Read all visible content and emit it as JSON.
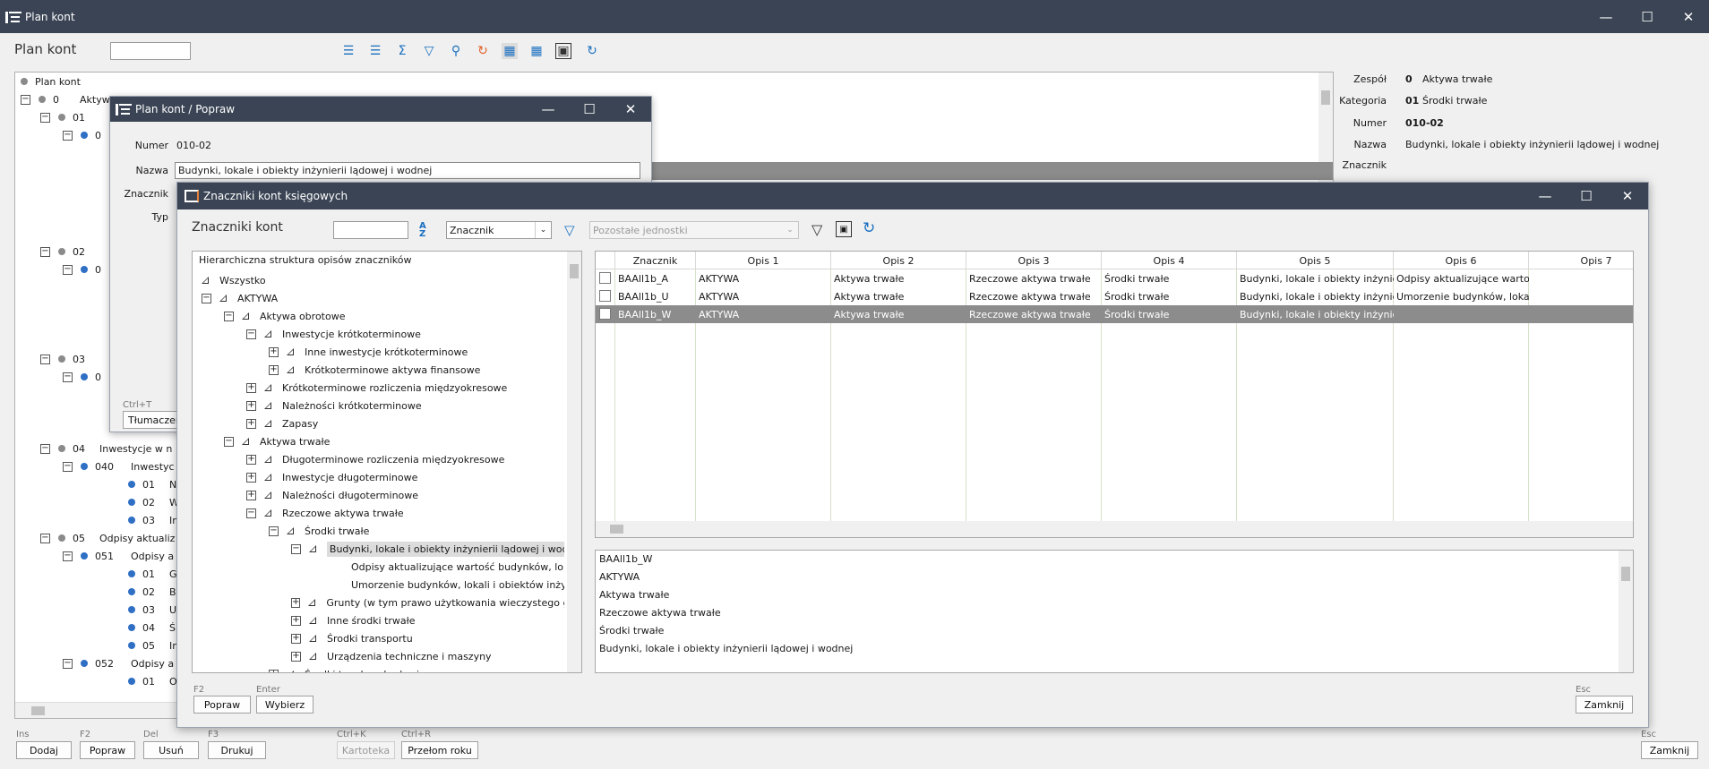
{
  "main_window": {
    "title": "Plan kont",
    "page_title": "Plan kont",
    "search_value": "",
    "tree": [
      {
        "code": "",
        "label": "Plan kont"
      },
      {
        "code": "0",
        "label": "Aktyw"
      },
      {
        "code": "01",
        "label": ""
      },
      {
        "code": "0",
        "label": ""
      },
      {
        "code": "02",
        "label": ""
      },
      {
        "code": "0",
        "label": ""
      },
      {
        "code": "03",
        "label": ""
      },
      {
        "code": "0",
        "label": ""
      },
      {
        "code": "04",
        "label": "Inwestycje w n"
      },
      {
        "code": "040",
        "label": "Inwestyc"
      },
      {
        "code": "01",
        "label": "Nieru"
      },
      {
        "code": "02",
        "label": "Warto"
      },
      {
        "code": "03",
        "label": "Inne i"
      },
      {
        "code": "05",
        "label": "Odpisy aktualiz"
      },
      {
        "code": "051",
        "label": "Odpisy a"
      },
      {
        "code": "01",
        "label": "Grun"
      },
      {
        "code": "02",
        "label": "Budy"
      },
      {
        "code": "03",
        "label": "Urzą"
      },
      {
        "code": "04",
        "label": "Środ"
      },
      {
        "code": "05",
        "label": "Inne s"
      },
      {
        "code": "052",
        "label": "Odpisy a"
      },
      {
        "code": "01",
        "label": "Odpis"
      }
    ],
    "details": {
      "zespol_label": "Zespół",
      "zespol_code": "0",
      "zespol_value": "Aktywa trwałe",
      "kategoria_label": "Kategoria",
      "kategoria_code": "01",
      "kategoria_value": "Środki trwałe",
      "numer_label": "Numer",
      "numer_value": "010-02",
      "nazwa_label": "Nazwa",
      "nazwa_value": "Budynki, lokale i obiekty inżynierii lądowej i wodnej",
      "znacznik_label": "Znacznik"
    },
    "bottom_buttons": [
      {
        "shortcut": "Ins",
        "label": "Dodaj"
      },
      {
        "shortcut": "F2",
        "label": "Popraw"
      },
      {
        "shortcut": "Del",
        "label": "Usuń"
      },
      {
        "shortcut": "F3",
        "label": "Drukuj"
      },
      {
        "shortcut": "Ctrl+K",
        "label": "Kartoteka"
      },
      {
        "shortcut": "Ctrl+R",
        "label": "Przełom roku"
      },
      {
        "shortcut": "Esc",
        "label": "Zamknij"
      }
    ]
  },
  "edit_window": {
    "title": "Plan kont / Popraw",
    "numer_label": "Numer",
    "numer_value": "010-02",
    "nazwa_label": "Nazwa",
    "nazwa_value": "Budynki, lokale i obiekty inżynierii lądowej i wodnej",
    "znacznik_label": "Znacznik",
    "typ_label": "Typ",
    "translate_shortcut": "Ctrl+T",
    "translate_button": "Tłumaczen"
  },
  "tags_window": {
    "title": "Znaczniki kont księgowych",
    "heading": "Znaczniki kont",
    "search_value": "",
    "sort_select": "Znacznik",
    "units_placeholder": "Pozostałe jednostki",
    "tree_header": "Hierarchiczna struktura opisów znaczników",
    "tree": [
      {
        "label": "Wszystko"
      },
      {
        "label": "AKTYWA"
      },
      {
        "label": "Aktywa obrotowe"
      },
      {
        "label": "Inwestycje krótkoterminowe"
      },
      {
        "label": "Inne inwestycje krótkoterminowe"
      },
      {
        "label": "Krótkoterminowe aktywa finansowe"
      },
      {
        "label": "Krótkoterminowe rozliczenia międzyokresowe"
      },
      {
        "label": "Należności krótkoterminowe"
      },
      {
        "label": "Zapasy"
      },
      {
        "label": "Aktywa trwałe"
      },
      {
        "label": "Długoterminowe rozliczenia międzyokresowe"
      },
      {
        "label": "Inwestycje długoterminowe"
      },
      {
        "label": "Należności długoterminowe"
      },
      {
        "label": "Rzeczowe aktywa trwałe"
      },
      {
        "label": "Środki trwałe"
      },
      {
        "label": "Budynki, lokale i obiekty inżynierii lądowej i wodnej"
      },
      {
        "label": "Odpisy aktualizujące wartość budynków, lokali i o"
      },
      {
        "label": "Umorzenie budynków, lokali i obiektów inżynierii lą"
      },
      {
        "label": "Grunty (w tym prawo użytkowania wieczystego grunt"
      },
      {
        "label": "Inne środki trwałe"
      },
      {
        "label": "Środki transportu"
      },
      {
        "label": "Urządzenia techniczne i maszyny"
      },
      {
        "label": "Środki trwałe w budowie"
      }
    ],
    "grid_columns": [
      "Znacznik",
      "Opis 1",
      "Opis 2",
      "Opis 3",
      "Opis 4",
      "Opis 5",
      "Opis 6",
      "Opis 7"
    ],
    "grid_rows": [
      [
        "BAAll1b_A",
        "AKTYWA",
        "Aktywa trwałe",
        "Rzeczowe aktywa trwałe",
        "Środki trwałe",
        "Budynki, lokale i obiekty inżynierii lą",
        "Odpisy aktualizujące wartość",
        ""
      ],
      [
        "BAAll1b_U",
        "AKTYWA",
        "Aktywa trwałe",
        "Rzeczowe aktywa trwałe",
        "Środki trwałe",
        "Budynki, lokale i obiekty inżynierii lą",
        "Umorzenie budynków, lokali i o",
        ""
      ],
      [
        "BAAll1b_W",
        "AKTYWA",
        "Aktywa trwałe",
        "Rzeczowe aktywa trwałe",
        "Środki trwałe",
        "Budynki, lokale i obiekty inżynierii lą",
        "",
        ""
      ]
    ],
    "preview_lines": [
      "BAAll1b_W",
      "AKTYWA",
      "Aktywa trwałe",
      "Rzeczowe aktywa trwałe",
      "Środki trwałe",
      "Budynki, lokale i obiekty inżynierii lądowej i wodnej"
    ],
    "buttons": {
      "popraw_shortcut": "F2",
      "popraw": "Popraw",
      "wybierz_shortcut": "Enter",
      "wybierz": "Wybierz",
      "zamknij_shortcut": "Esc",
      "zamknij": "Zamknij"
    }
  },
  "colors": {
    "titlebar": "#3a4454",
    "selection": "#8c8c8c",
    "accent": "#1a6fc0"
  }
}
